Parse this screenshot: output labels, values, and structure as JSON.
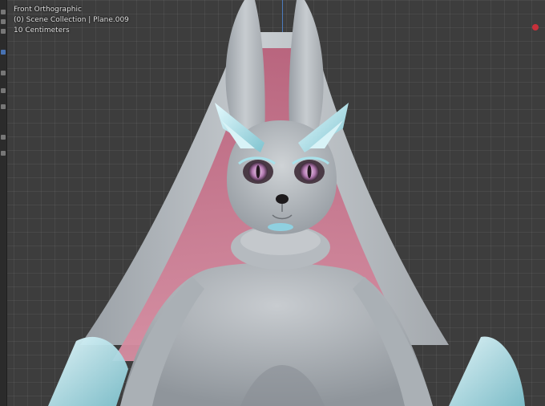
{
  "viewport": {
    "view_name": "Front Orthographic",
    "collection_line": "(0) Scene Collection | Plane.009",
    "scale_line": "10 Centimeters"
  },
  "toolbar": {
    "tools": [
      "tweak-tool",
      "select-tool",
      "cursor-tool",
      "move-tool",
      "rotate-tool",
      "scale-tool",
      "transform-tool",
      "annotate-tool",
      "measure-tool"
    ]
  },
  "colors": {
    "background": "#3d3d3d",
    "axis_line": "#4f86d4",
    "record_dot": "#c8303a",
    "fur": "#b9bfc4",
    "ear_inner": "#c9788e",
    "crystal": "#b7e3ea"
  }
}
